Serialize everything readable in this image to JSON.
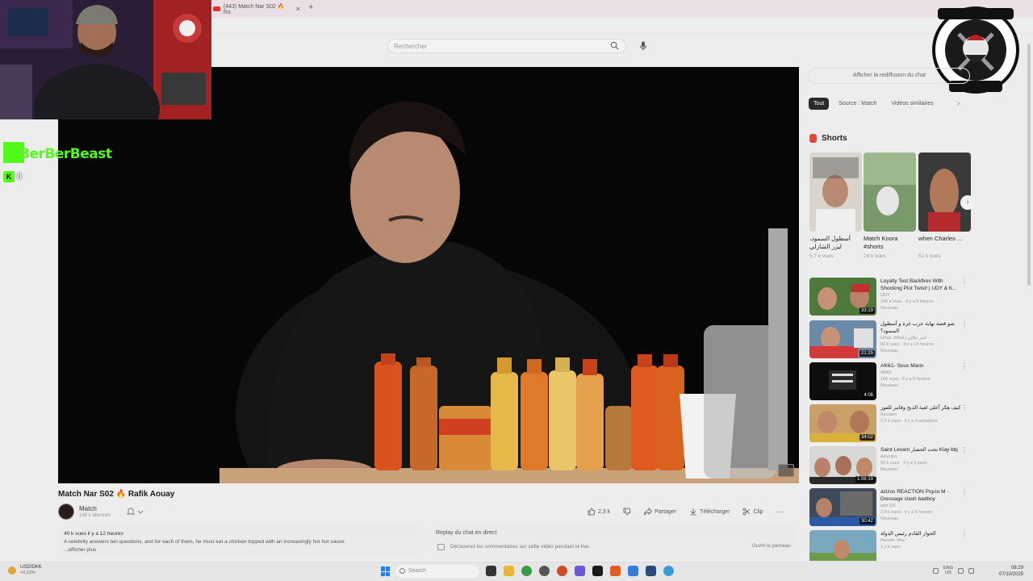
{
  "browser": {
    "tab_title": "(443) Match Nar S02 🔥 Ra",
    "new_tab_symbol": "+",
    "close_symbol": "×"
  },
  "header": {
    "search_placeholder": "Rechercher"
  },
  "overlay": {
    "streamer_name": "BerBerBeast",
    "viewer_count": "8"
  },
  "video": {
    "title": "Match Nar S02 🔥 Rafik Aouay",
    "channel": "Match",
    "subscribers": "168 k abonnés",
    "likes": "2,3 k",
    "share": "Partager",
    "download": "Télécharger",
    "clip": "Clip",
    "stats": "40 k vues  il y a 12 heures",
    "description": "A celebrity answers ten questions, and for each of them, he must eat a chicken topped with an increasingly hot hot sauce.",
    "more": "...afficher plus"
  },
  "chat_replay": {
    "title": "Replay du chat en direct",
    "description": "Découvrez les commentaires sur cette vidéo pendant le live.",
    "button": "Ouvrir le panneau"
  },
  "sidebar": {
    "show_chat": "Afficher la rediffusion du chat",
    "chips": [
      "Tout",
      "Source : Match",
      "Vidéos similaires"
    ],
    "shorts_heading": "Shorts",
    "shorts": [
      {
        "title": "أسطول السمود، ليزر الشارلي",
        "views": "5,7 k vues"
      },
      {
        "title": "Match Koora #shorts",
        "views": "24 k vues"
      },
      {
        "title": "when Charles ...",
        "views": "51 k vues"
      }
    ],
    "recommended": [
      {
        "title": "Loyalty Test Backfires With Shocking Plot Twist! | UDY & K...",
        "channel": "UDY",
        "meta": "245 k vues · il y a 5 heures",
        "badge": "Nouveau",
        "duration": "33:19"
      },
      {
        "title": "شو قصة نهاية حرب غزة و أسطول السمود؟",
        "channel": "Omar Jellali | عمر جلالي",
        "meta": "82 k vues · il y a 14 heures",
        "badge": "Nouveau",
        "duration": "21:25"
      },
      {
        "title": "Afrik1- Sous Marin",
        "channel": "Afrik1",
        "meta": "106 vues · il y a 9 heures",
        "badge": "Nouveau",
        "duration": "4:06"
      },
      {
        "title": "كيف هكر أعلى لعبة الذبح وقامر للفوز",
        "channel": "Azuzaro",
        "meta": "2,5 k vues · il y a 4 semaines",
        "badge": "",
        "duration": "34:02"
      },
      {
        "title": "Saint Levant تحت الحصار Klay bbj",
        "channel": "Azuzaro",
        "meta": "53 k vues · il y a 5 jours",
        "badge": "Nouveau",
        "duration": "1:08:19"
      },
      {
        "title": "azizos REACTION Psyco M - Dressage clash badboy",
        "channel": "aziz DS",
        "meta": "2,4 k vues · il y a 5 heures",
        "badge": "Nouveau",
        "duration": "30:42"
      },
      {
        "title": "الحوار القادم رئيس الدولة",
        "channel": "Nessim Sha",
        "meta": "1,1 k vues",
        "badge": "",
        "duration": ""
      }
    ]
  },
  "taskbar": {
    "weather_line1": "USD/DKK",
    "weather_line2": "+0,22%",
    "search": "Search",
    "lang_line1": "ENG",
    "lang_line2": "US",
    "time": "08:29",
    "date": "07/10/2025"
  },
  "colors": {
    "kick_green": "#53fc18",
    "youtube_red": "#e03030",
    "shorts_red": "#e8453a"
  }
}
